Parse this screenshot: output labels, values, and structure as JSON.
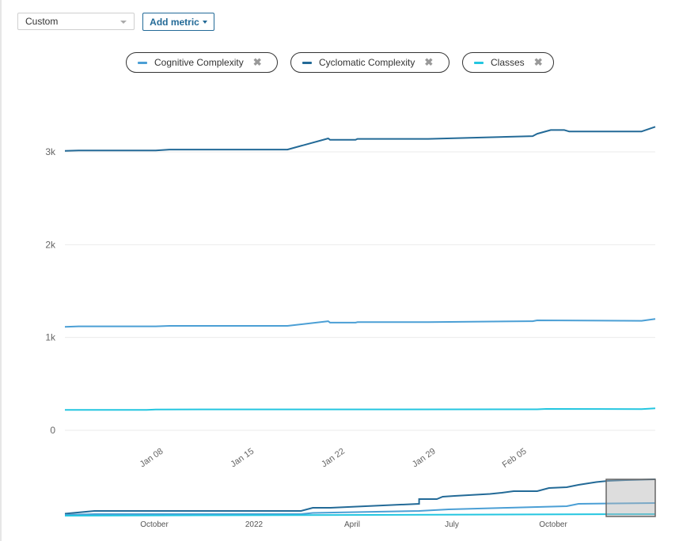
{
  "toolbar": {
    "preset_select": {
      "value": "Custom"
    },
    "add_metric_label": "Add metric"
  },
  "legend": [
    {
      "label": "Cognitive Complexity",
      "color": "#4b9fd5",
      "close_icon": "close-icon"
    },
    {
      "label": "Cyclomatic Complexity",
      "color": "#236a97",
      "close_icon": "close-icon"
    },
    {
      "label": "Classes",
      "color": "#24c6e0",
      "close_icon": "close-icon"
    }
  ],
  "chart_data": {
    "type": "line",
    "title": "",
    "xlabel": "",
    "ylabel": "",
    "ylim": [
      0,
      3400
    ],
    "y_ticks": [
      {
        "value": 0,
        "label": "0"
      },
      {
        "value": 1000,
        "label": "1k"
      },
      {
        "value": 2000,
        "label": "2k"
      },
      {
        "value": 3000,
        "label": "3k"
      }
    ],
    "x_ticks": [
      "Jan 08",
      "Jan 15",
      "Jan 22",
      "Jan 29",
      "Feb 05"
    ],
    "x_tick_positions": [
      1,
      2,
      3,
      4,
      5
    ],
    "xlim": [
      -0.0,
      6.5
    ],
    "grid": true,
    "series": [
      {
        "name": "Cyclomatic Complexity",
        "color": "#236a97",
        "x": [
          0,
          0.15,
          1.0,
          1.15,
          2.45,
          2.9,
          2.92,
          3.2,
          3.22,
          4.0,
          5.15,
          5.2,
          5.35,
          5.5,
          5.55,
          6.35,
          6.5
        ],
        "y": [
          3010,
          3015,
          3015,
          3025,
          3025,
          3145,
          3130,
          3130,
          3140,
          3140,
          3170,
          3195,
          3235,
          3235,
          3220,
          3220,
          3270
        ]
      },
      {
        "name": "Cognitive Complexity",
        "color": "#4b9fd5",
        "x": [
          0,
          0.15,
          1.0,
          1.15,
          2.45,
          2.9,
          2.92,
          3.2,
          3.22,
          4.0,
          5.1,
          5.15,
          5.2,
          6.35,
          6.5
        ],
        "y": [
          1115,
          1120,
          1120,
          1125,
          1125,
          1175,
          1160,
          1160,
          1165,
          1165,
          1175,
          1175,
          1185,
          1180,
          1200
        ]
      },
      {
        "name": "Classes",
        "color": "#24c6e0",
        "x": [
          0,
          0.9,
          1.0,
          5.2,
          5.3,
          6.35,
          6.5
        ],
        "y": [
          220,
          220,
          224,
          226,
          230,
          228,
          236
        ]
      }
    ],
    "navigator": {
      "x_ticks": [
        "October",
        "2022",
        "April",
        "July",
        "October"
      ],
      "selected_range_fraction": [
        0.92,
        1.0
      ],
      "series": [
        {
          "name": "Cyclomatic Complexity",
          "x": [
            0,
            0.05,
            0.4,
            0.42,
            0.45,
            0.6,
            0.6,
            0.63,
            0.64,
            0.66,
            0.72,
            0.74,
            0.76,
            0.8,
            0.82,
            0.85,
            0.87,
            0.9,
            0.92,
            0.95,
            1.0
          ],
          "y": [
            0.05,
            0.12,
            0.12,
            0.2,
            0.2,
            0.3,
            0.42,
            0.42,
            0.48,
            0.5,
            0.55,
            0.58,
            0.62,
            0.62,
            0.7,
            0.72,
            0.78,
            0.85,
            0.88,
            0.9,
            0.92
          ]
        },
        {
          "name": "Cognitive Complexity",
          "x": [
            0,
            0.05,
            0.4,
            0.42,
            0.6,
            0.65,
            0.75,
            0.85,
            0.87,
            1.0
          ],
          "y": [
            0.02,
            0.04,
            0.04,
            0.07,
            0.12,
            0.16,
            0.2,
            0.24,
            0.3,
            0.32
          ]
        },
        {
          "name": "Classes",
          "x": [
            0,
            1.0
          ],
          "y": [
            0.0,
            0.04
          ]
        }
      ]
    }
  }
}
